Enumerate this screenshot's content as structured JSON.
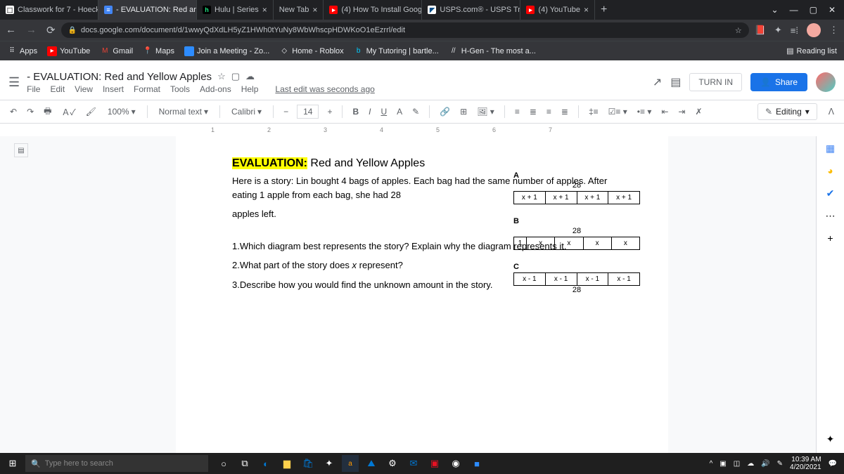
{
  "tabs": [
    {
      "label": "Classwork for 7 - Hoeck",
      "icon": "⬚",
      "iconBg": "#fff"
    },
    {
      "label": "- EVALUATION: Red and",
      "icon": "≡",
      "iconBg": "#4285f4",
      "active": true
    },
    {
      "label": "Hulu | Series",
      "icon": "h",
      "iconBg": "#1ce783"
    },
    {
      "label": "New Tab"
    },
    {
      "label": "(4) How To Install Goog",
      "icon": "▸",
      "iconBg": "#f00"
    },
    {
      "label": "USPS.com® - USPS Tra",
      "icon": "◤",
      "iconBg": "#fff"
    },
    {
      "label": "(4) YouTube",
      "icon": "▸",
      "iconBg": "#f00"
    }
  ],
  "url": "docs.google.com/document/d/1wwyQdXdLH5yZ1HWh0tYuNy8WbWhscpHDWKoO1eEzrrl/edit",
  "bookmarks": [
    {
      "label": "Apps",
      "icon": "⠿"
    },
    {
      "label": "YouTube",
      "icon": "▸",
      "iconBg": "#f00"
    },
    {
      "label": "Gmail",
      "icon": "M",
      "iconBg": "#ea4335"
    },
    {
      "label": "Maps",
      "icon": "📍"
    },
    {
      "label": "Join a Meeting - Zo...",
      "icon": "■",
      "iconBg": "#2d8cff"
    },
    {
      "label": "Home - Roblox",
      "icon": "◇"
    },
    {
      "label": "My Tutoring | bartle...",
      "icon": "b",
      "iconBg": "#0066cc"
    },
    {
      "label": "H-Gen - The most a...",
      "icon": "//"
    }
  ],
  "readingList": "Reading list",
  "docTitle": "- EVALUATION: Red and Yellow Apples",
  "menus": [
    "File",
    "Edit",
    "View",
    "Insert",
    "Format",
    "Tools",
    "Add-ons",
    "Help"
  ],
  "lastEdit": "Last edit was seconds ago",
  "turnIn": "TURN IN",
  "share": "Share",
  "zoom": "100%",
  "styleName": "Normal text",
  "fontName": "Calibri",
  "fontSize": "14",
  "editing": "Editing",
  "rulerMarks": [
    "1",
    "2",
    "3",
    "4",
    "5",
    "6",
    "7"
  ],
  "doc": {
    "title_hl": "EVALUATION:",
    "title_rest": " Red and Yellow Apples",
    "story": "Here is a story: Lin bought 4 bags of apples. Each bag had the same number of apples. After eating 1 apple from each bag, she had 28",
    "story2": "apples left.",
    "q1": "1.Which diagram best represents the story? Explain why the diagram represents it.",
    "q2": "2.What part of the story does x represent?",
    "q3": "3.Describe how you would find the unknown amount in the story."
  },
  "diagrams": {
    "A": {
      "label": "A",
      "top": "28",
      "cells": [
        "x + 1",
        "x + 1",
        "x + 1",
        "x + 1"
      ]
    },
    "B": {
      "label": "B",
      "top": "28",
      "cells": [
        "1",
        "x",
        "x",
        "x",
        "x"
      ]
    },
    "C": {
      "label": "C",
      "bottom": "28",
      "cells": [
        "x - 1",
        "x - 1",
        "x - 1",
        "x - 1"
      ]
    }
  },
  "taskbar": {
    "search": "Type here to search",
    "time": "10:39 AM",
    "date": "4/20/2021"
  }
}
